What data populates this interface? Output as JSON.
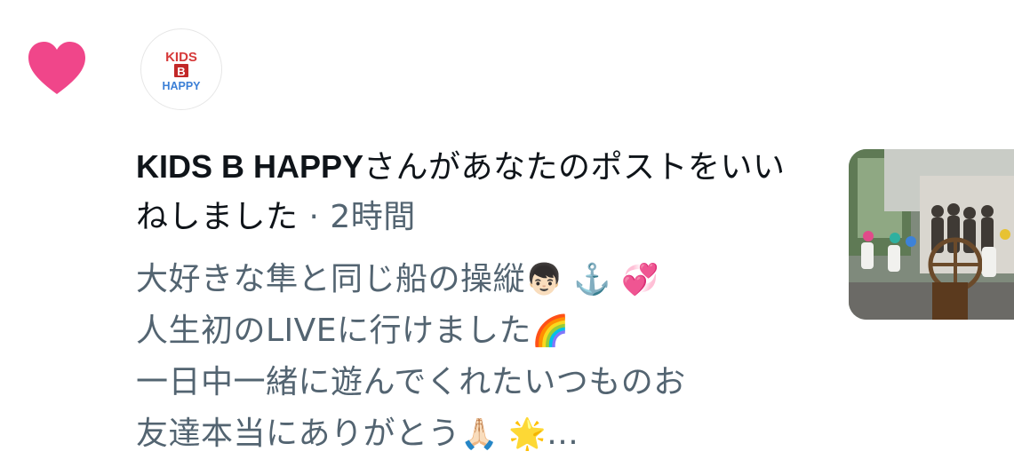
{
  "notification": {
    "type": "like",
    "icon": "heart-icon",
    "accent_color": "#f0468a",
    "avatar": {
      "icon": "kids-b-happy-logo",
      "logo_lines": [
        "KIDS",
        "B",
        "HAPPY"
      ]
    },
    "user_name": "KIDS B HAPPY",
    "action_text": "さんがあなたのポストをいいねしました",
    "separator": " · ",
    "time_ago": "2時間",
    "post_lines": [
      {
        "text": "大好きな隼と同じ船の操縦",
        "emoji": "👦🏻 ⚓️ 💞"
      },
      {
        "text": "人生初のLIVEに行けました",
        "emoji": "🌈"
      },
      {
        "text": "一日中一緒に遊んでくれたいつものお",
        "emoji": ""
      },
      {
        "text": "友達本当にありがとう",
        "emoji": "🙏🏻 🌟"
      }
    ],
    "ellipsis": "…",
    "thumbnail": {
      "icon": "post-photo-thumbnail"
    }
  }
}
